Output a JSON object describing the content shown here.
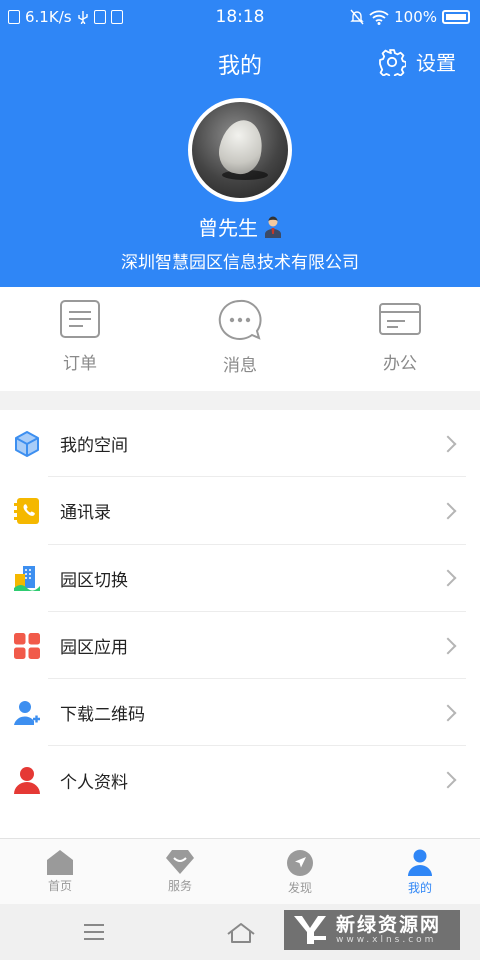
{
  "status_bar": {
    "net_speed": "6.1K/s",
    "time": "18:18",
    "battery": "100%"
  },
  "header": {
    "title": "我的",
    "settings_label": "设置",
    "user_name": "曾先生",
    "company": "深圳智慧园区信息技术有限公司"
  },
  "quick_actions": [
    {
      "label": "订单",
      "icon": "order-list-icon"
    },
    {
      "label": "消息",
      "icon": "message-bubble-icon"
    },
    {
      "label": "办公",
      "icon": "office-card-icon"
    }
  ],
  "menu": [
    {
      "label": "我的空间",
      "icon": "cube-icon",
      "color": "#3d8ff0"
    },
    {
      "label": "通讯录",
      "icon": "contacts-phone-icon",
      "color": "#f5b800"
    },
    {
      "label": "园区切换",
      "icon": "park-switch-icon",
      "color": "#3d8ff0"
    },
    {
      "label": "园区应用",
      "icon": "app-grid-icon",
      "color": "#f15a4a"
    },
    {
      "label": "下载二维码",
      "icon": "user-add-icon",
      "color": "#3d8ff0"
    },
    {
      "label": "个人资料",
      "icon": "person-icon",
      "color": "#e53935"
    }
  ],
  "tab_bar": [
    {
      "label": "首页",
      "icon": "home-icon",
      "active": false
    },
    {
      "label": "服务",
      "icon": "service-icon",
      "active": false
    },
    {
      "label": "发现",
      "icon": "compass-icon",
      "active": false
    },
    {
      "label": "我的",
      "icon": "user-icon",
      "active": true
    }
  ],
  "watermark": {
    "title": "新绿资源网",
    "url": "www.xlns.com"
  },
  "colors": {
    "brand_blue": "#2f86f6",
    "inactive_gray": "#999999"
  }
}
